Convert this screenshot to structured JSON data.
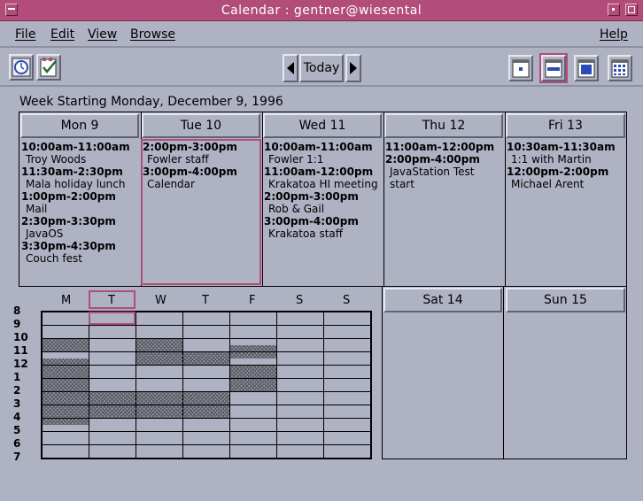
{
  "window": {
    "title": "Calendar : gentner@wiesental"
  },
  "menu": {
    "file": "File",
    "edit": "Edit",
    "view": "View",
    "browse": "Browse",
    "help": "Help"
  },
  "toolbar": {
    "today": "Today"
  },
  "week": {
    "label": "Week Starting Monday, December  9, 1996",
    "days": [
      {
        "header": "Mon 9",
        "appts": [
          {
            "time": "10:00am-11:00am",
            "what": "Troy Woods"
          },
          {
            "time": "11:30am-2:30pm",
            "what": "Mala holiday lunch"
          },
          {
            "time": "1:00pm-2:00pm",
            "what": "Mail"
          },
          {
            "time": "2:30pm-3:30pm",
            "what": "JavaOS"
          },
          {
            "time": "3:30pm-4:30pm",
            "what": "Couch fest"
          }
        ]
      },
      {
        "header": "Tue 10",
        "appts": [
          {
            "time": "2:00pm-3:00pm",
            "what": "Fowler staff"
          },
          {
            "time": "3:00pm-4:00pm",
            "what": "Calendar"
          }
        ]
      },
      {
        "header": "Wed 11",
        "appts": [
          {
            "time": "10:00am-11:00am",
            "what": "Fowler 1:1"
          },
          {
            "time": "11:00am-12:00pm",
            "what": "Krakatoa HI meeting"
          },
          {
            "time": "2:00pm-3:00pm",
            "what": "Rob & Gail"
          },
          {
            "time": "3:00pm-4:00pm",
            "what": "Krakatoa staff"
          }
        ]
      },
      {
        "header": "Thu 12",
        "appts": [
          {
            "time": "11:00am-12:00pm",
            "what": ""
          },
          {
            "time": "2:00pm-4:00pm",
            "what": "JavaStation Test start"
          }
        ]
      },
      {
        "header": "Fri 13",
        "appts": [
          {
            "time": "10:30am-11:30am",
            "what": "1:1 with Martin"
          },
          {
            "time": "12:00pm-2:00pm",
            "what": "Michael Arent"
          }
        ]
      }
    ],
    "weekend": [
      {
        "header": "Sat 14"
      },
      {
        "header": "Sun 15"
      }
    ]
  },
  "mini": {
    "day_letters": [
      "M",
      "T",
      "W",
      "T",
      "F",
      "S",
      "S"
    ],
    "hours": [
      "8",
      "9",
      "10",
      "11",
      "12",
      "1",
      "2",
      "3",
      "4",
      "5",
      "6",
      "7"
    ],
    "busy": [
      {
        "day": 0,
        "start": 10.0,
        "end": 11.0
      },
      {
        "day": 0,
        "start": 11.5,
        "end": 14.5
      },
      {
        "day": 0,
        "start": 13.0,
        "end": 14.0
      },
      {
        "day": 0,
        "start": 14.5,
        "end": 16.5
      },
      {
        "day": 1,
        "start": 14.0,
        "end": 16.0
      },
      {
        "day": 2,
        "start": 10.0,
        "end": 12.0
      },
      {
        "day": 2,
        "start": 14.0,
        "end": 16.0
      },
      {
        "day": 3,
        "start": 11.0,
        "end": 12.0
      },
      {
        "day": 3,
        "start": 14.0,
        "end": 16.0
      },
      {
        "day": 4,
        "start": 10.5,
        "end": 11.5
      },
      {
        "day": 4,
        "start": 12.0,
        "end": 14.0
      }
    ]
  },
  "colors": {
    "accent": "#b24d7a",
    "background": "#aeb2c3"
  }
}
